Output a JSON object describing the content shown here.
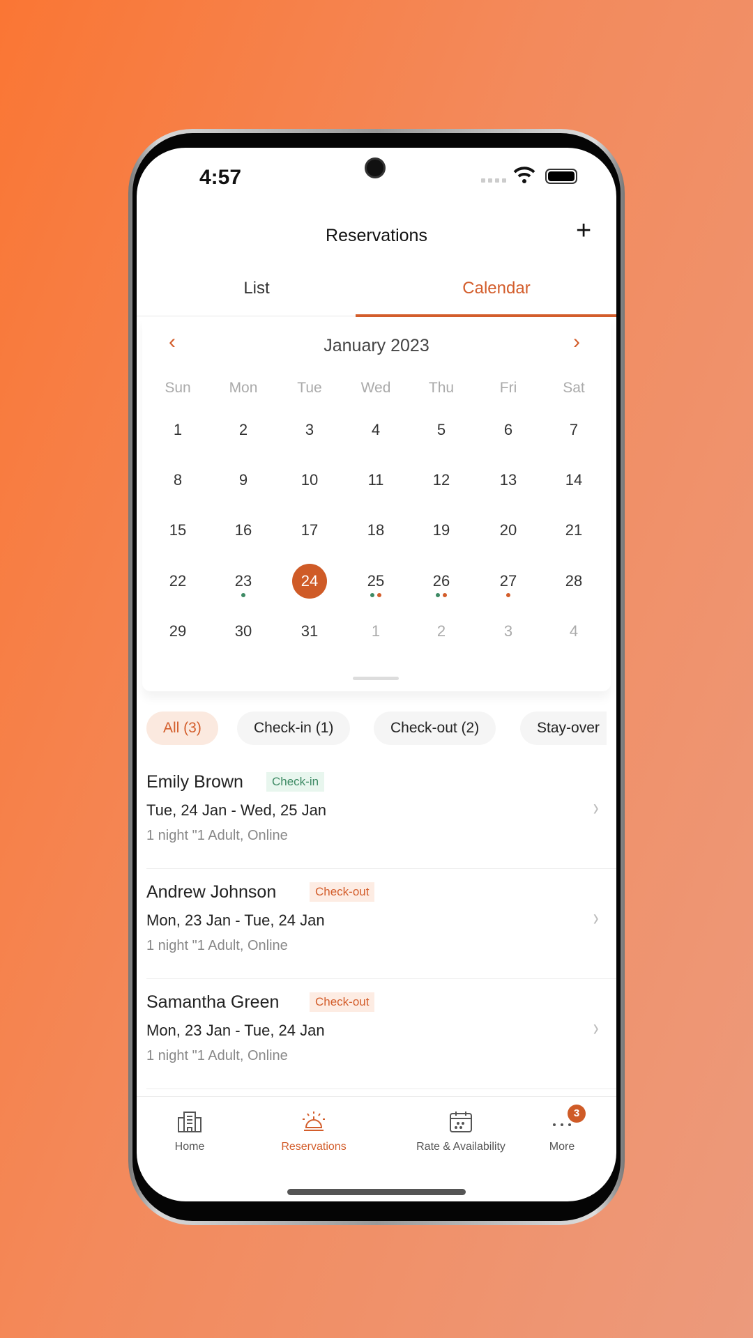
{
  "status": {
    "time": "4:57"
  },
  "header": {
    "title": "Reservations",
    "add_icon": "plus-icon"
  },
  "tabs": [
    {
      "label": "List",
      "active": false
    },
    {
      "label": "Calendar",
      "active": true
    }
  ],
  "calendar": {
    "month": "January 2023",
    "weekdays": [
      "Sun",
      "Mon",
      "Tue",
      "Wed",
      "Thu",
      "Fri",
      "Sat"
    ],
    "weeks": [
      [
        "1",
        "2",
        "3",
        "4",
        "5",
        "6",
        "7"
      ],
      [
        "8",
        "9",
        "10",
        "11",
        "12",
        "13",
        "14"
      ],
      [
        "15",
        "16",
        "17",
        "18",
        "19",
        "20",
        "21"
      ],
      [
        "22",
        "23",
        "24",
        "25",
        "26",
        "27",
        "28"
      ],
      [
        "29",
        "30",
        "31",
        "1",
        "2",
        "3",
        "4"
      ]
    ],
    "selected": "24",
    "dot_colors": {
      "checkin": "#3d8a64",
      "checkout": "#d35d2b"
    }
  },
  "filters": [
    {
      "label": "All (3)",
      "active": true
    },
    {
      "label": "Check-in (1)"
    },
    {
      "label": "Check-out (2)"
    },
    {
      "label": "Stay-over"
    }
  ],
  "reservations": [
    {
      "name": "Emily Brown",
      "badge": "Check-in",
      "dates": "Tue, 24 Jan - Wed, 25 Jan",
      "details": "1 night \"1 Adult, Online"
    },
    {
      "name": "Andrew Johnson",
      "badge": "Check-out",
      "dates": "Mon, 23 Jan - Tue, 24 Jan",
      "details": "1 night \"1 Adult, Online"
    },
    {
      "name": "Samantha Green",
      "badge": "Check-out",
      "dates": "Mon, 23 Jan - Tue, 24 Jan",
      "details": "1 night \"1 Adult, Online"
    }
  ],
  "nav": [
    {
      "label": "Home",
      "icon": "building-icon"
    },
    {
      "label": "Reservations",
      "icon": "service-bell-icon",
      "active": true
    },
    {
      "label": "Rate & Availability",
      "icon": "calendar-icon"
    },
    {
      "label": "More",
      "icon": "more-dots-icon",
      "badge": "3"
    }
  ],
  "colors": {
    "accent": "#d35d2b",
    "checkin_bg": "#e8f6ee",
    "checkin_fg": "#3d8a64",
    "checkout_bg": "#fdece3"
  }
}
